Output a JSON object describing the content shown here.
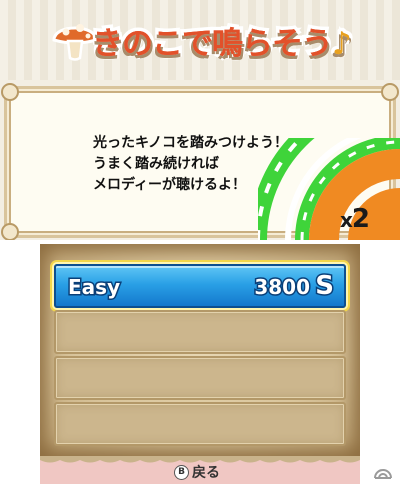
{
  "top": {
    "title_main": "きのこで鳴らそう",
    "title_note": "♪",
    "description": [
      "光ったキノコを踏みつけよう！",
      "うまく踏み続ければ",
      "メロディーが聴けるよ！"
    ],
    "multiplier_x": "x",
    "multiplier_value": "2"
  },
  "songs": {
    "selected": {
      "name": "Easy",
      "score": "3800",
      "rank": "S"
    }
  },
  "footer": {
    "back_button_glyph": "B",
    "back_label": "戻る"
  },
  "colors": {
    "title": "#e2512a",
    "selected_row": "#2aa0e6",
    "ring_green": "#3fd43a",
    "ring_orange": "#f08a22",
    "footer": "#f0c7c3"
  },
  "icons": [
    "mushroom-icon",
    "music-note-icon",
    "b-button-icon",
    "watermark-icon"
  ]
}
